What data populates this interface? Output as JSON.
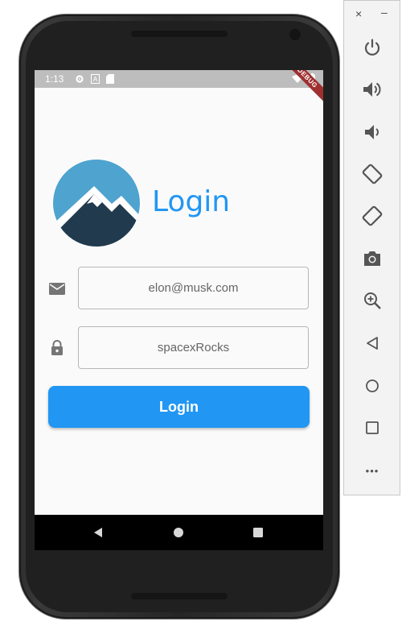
{
  "status_bar": {
    "time": "1:13",
    "debug_label": "DEBUG"
  },
  "app": {
    "title": "Login",
    "email_value": "elon@musk.com",
    "password_value": "spacexRocks",
    "login_button_label": "Login"
  },
  "emulator_toolbar": {
    "close_label": "×",
    "minimize_label": "–",
    "more_label": "•••"
  },
  "colors": {
    "accent": "#2196f3",
    "logo_sky": "#4fa3cf",
    "logo_mountain": "#213a4d",
    "status_bar": "#bdbdbd"
  },
  "icons": [
    "settings-icon",
    "accessibility-icon",
    "sd-card-icon",
    "wifi-icon",
    "battery-icon",
    "email-icon",
    "lock-icon",
    "power-icon",
    "volume-up-icon",
    "volume-down-icon",
    "rotate-left-icon",
    "rotate-right-icon",
    "camera-icon",
    "zoom-icon",
    "back-icon",
    "home-icon",
    "overview-icon",
    "more-icon"
  ]
}
